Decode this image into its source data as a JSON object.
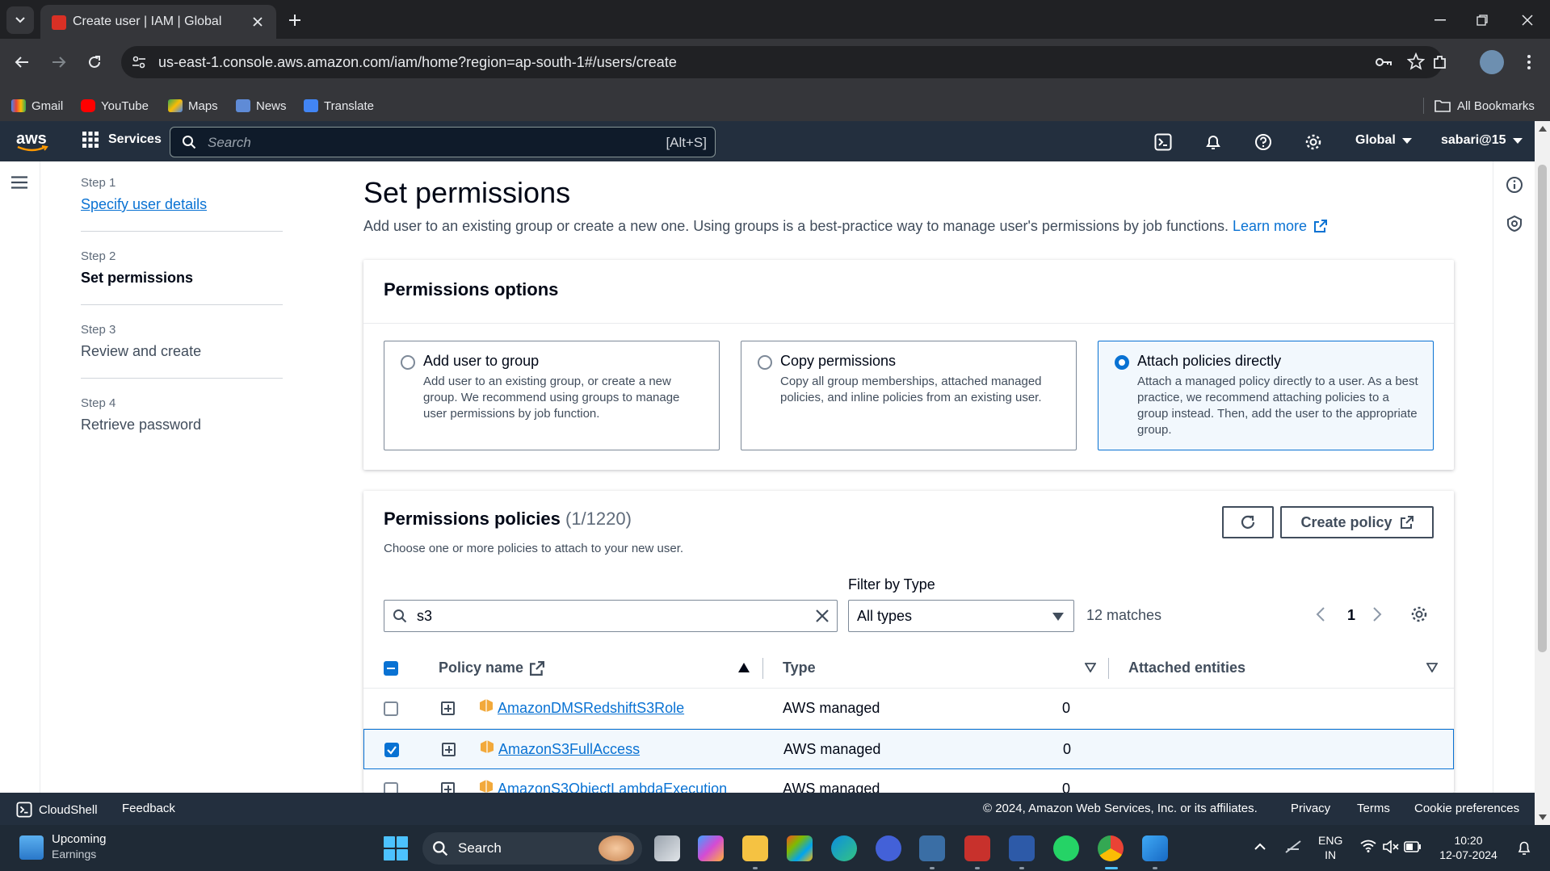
{
  "browser": {
    "tab_title": "Create user | IAM | Global",
    "url": "us-east-1.console.aws.amazon.com/iam/home?region=ap-south-1#/users/create",
    "bookmarks": [
      "Gmail",
      "YouTube",
      "Maps",
      "News",
      "Translate"
    ],
    "all_bookmarks": "All Bookmarks"
  },
  "aws_nav": {
    "logo": "aws",
    "services": "Services",
    "search_placeholder": "Search",
    "search_shortcut": "[Alt+S]",
    "region": "Global",
    "account": "sabari@15"
  },
  "steps": [
    {
      "num": "Step 1",
      "label": "Specify user details"
    },
    {
      "num": "Step 2",
      "label": "Set permissions"
    },
    {
      "num": "Step 3",
      "label": "Review and create"
    },
    {
      "num": "Step 4",
      "label": "Retrieve password"
    }
  ],
  "main": {
    "title": "Set permissions",
    "description": "Add user to an existing group or create a new one. Using groups is a best-practice way to manage user's permissions by job functions.",
    "learn_more": "Learn more"
  },
  "permissions_options": {
    "title": "Permissions options",
    "options": [
      {
        "title": "Add user to group",
        "desc": "Add user to an existing group, or create a new group. We recommend using groups to manage user permissions by job function.",
        "selected": false
      },
      {
        "title": "Copy permissions",
        "desc": "Copy all group memberships, attached managed policies, and inline policies from an existing user.",
        "selected": false
      },
      {
        "title": "Attach policies directly",
        "desc": "Attach a managed policy directly to a user. As a best practice, we recommend attaching policies to a group instead. Then, add the user to the appropriate group.",
        "selected": true
      }
    ]
  },
  "policies": {
    "title": "Permissions policies",
    "count": "(1/1220)",
    "description": "Choose one or more policies to attach to your new user.",
    "create_policy": "Create policy",
    "filter_label": "Filter by Type",
    "search_value": "s3",
    "type_value": "All types",
    "matches": "12 matches",
    "page": "1",
    "columns": {
      "name": "Policy name",
      "type": "Type",
      "entities": "Attached entities"
    },
    "rows": [
      {
        "name": "AmazonDMSRedshiftS3Role",
        "type": "AWS managed",
        "entities": "0",
        "checked": false
      },
      {
        "name": "AmazonS3FullAccess",
        "type": "AWS managed",
        "entities": "0",
        "checked": true
      },
      {
        "name": "AmazonS3ObjectLambdaExecution",
        "type": "AWS managed",
        "entities": "0",
        "checked": false
      }
    ]
  },
  "footer": {
    "cloudshell": "CloudShell",
    "feedback": "Feedback",
    "copyright": "© 2024, Amazon Web Services, Inc. or its affiliates.",
    "privacy": "Privacy",
    "terms": "Terms",
    "cookies": "Cookie preferences"
  },
  "taskbar": {
    "weather_title": "Upcoming",
    "weather_sub": "Earnings",
    "search": "Search",
    "lang_1": "ENG",
    "lang_2": "IN",
    "time": "10:20",
    "date": "12-07-2024"
  },
  "colors": {
    "accent": "#0972d3",
    "nav_bg": "#232f3e",
    "browser_bg": "#35363a"
  }
}
